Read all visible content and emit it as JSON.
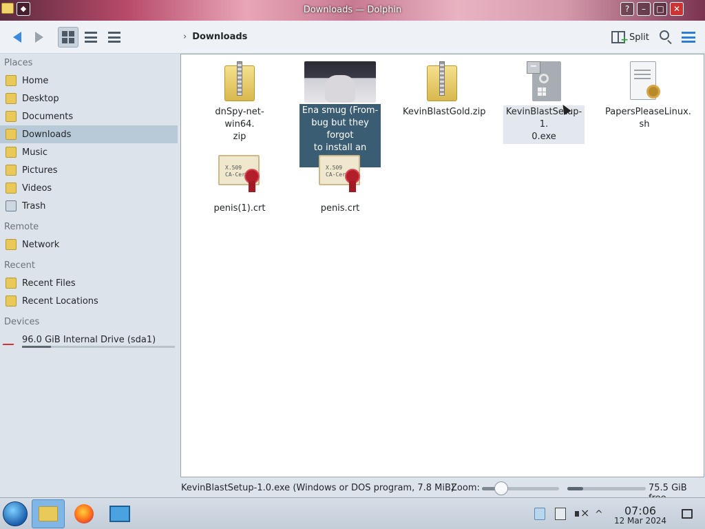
{
  "window": {
    "title": "Downloads — Dolphin",
    "menu_glyph": "◆",
    "buttons": [
      "?",
      "–",
      "□",
      "✕"
    ]
  },
  "toolbar": {
    "breadcrumb_chevron": "›",
    "breadcrumb": "Downloads",
    "split_label": "Split",
    "split_plus": "+"
  },
  "sidebar": {
    "sections": [
      {
        "heading": "Places",
        "items": [
          {
            "label": "Home",
            "icon": "home-icon"
          },
          {
            "label": "Desktop",
            "icon": "desktop-icon"
          },
          {
            "label": "Documents",
            "icon": "documents-icon"
          },
          {
            "label": "Downloads",
            "icon": "downloads-icon",
            "selected": true
          },
          {
            "label": "Music",
            "icon": "music-icon"
          },
          {
            "label": "Pictures",
            "icon": "pictures-icon"
          },
          {
            "label": "Videos",
            "icon": "videos-icon"
          },
          {
            "label": "Trash",
            "icon": "trash-icon"
          }
        ]
      },
      {
        "heading": "Remote",
        "items": [
          {
            "label": "Network",
            "icon": "network-icon"
          }
        ]
      },
      {
        "heading": "Recent",
        "items": [
          {
            "label": "Recent Files",
            "icon": "recent-files-icon"
          },
          {
            "label": "Recent Locations",
            "icon": "recent-locations-icon"
          }
        ]
      },
      {
        "heading": "Devices",
        "items": [
          {
            "label": "96.0 GiB Internal Drive (sda1)",
            "icon": "drive-icon",
            "usage_fraction": 0.19
          }
        ]
      }
    ]
  },
  "files": [
    {
      "label": "dnSpy-net-win64.zip",
      "label_lines": [
        "dnSpy-net-win64.",
        "zip"
      ],
      "icon": "zip-icon"
    },
    {
      "label": "Ena smug (From-bug but they forgot to install an a....png",
      "label_lines": [
        "Ena smug (From-",
        "bug but they forgot",
        "to install an a....png"
      ],
      "icon": "image-thumbnail",
      "selected": true
    },
    {
      "label": "KevinBlastGold.zip",
      "label_lines": [
        "KevinBlastGold.zip"
      ],
      "icon": "zip-icon"
    },
    {
      "label": "KevinBlastSetup-1.0.exe",
      "label_lines": [
        "KevinBlastSetup-1.",
        "0.exe"
      ],
      "icon": "executable-icon",
      "hovered": true
    },
    {
      "label": "PapersPleaseLinux.sh",
      "label_lines": [
        "PapersPleaseLinux.",
        "sh"
      ],
      "icon": "shell-script-icon"
    },
    {
      "label": "penis(1).crt",
      "label_lines": [
        "penis(1).crt"
      ],
      "icon": "certificate-icon"
    },
    {
      "label": "penis.crt",
      "label_lines": [
        "penis.crt"
      ],
      "icon": "certificate-icon"
    }
  ],
  "certificate_card_text": [
    "X.509",
    "CA-Cert"
  ],
  "statusbar": {
    "info": "KevinBlastSetup-1.0.exe (Windows or DOS program, 7.8 MiB)",
    "zoom_label": "Zoom:",
    "zoom_fraction": 0.25,
    "disk_used_fraction": 0.2,
    "free_space": "75.5 GiB free"
  },
  "taskbar": {
    "apps": [
      "file-manager",
      "firefox",
      "system-settings"
    ],
    "tray_expand_glyph": "^",
    "time": "07:06",
    "date": "12 Mar 2024"
  },
  "colors": {
    "selection": "#3a5d74",
    "sidebar_selection": "#b8c9d8",
    "accent": "#2a7fd4"
  }
}
